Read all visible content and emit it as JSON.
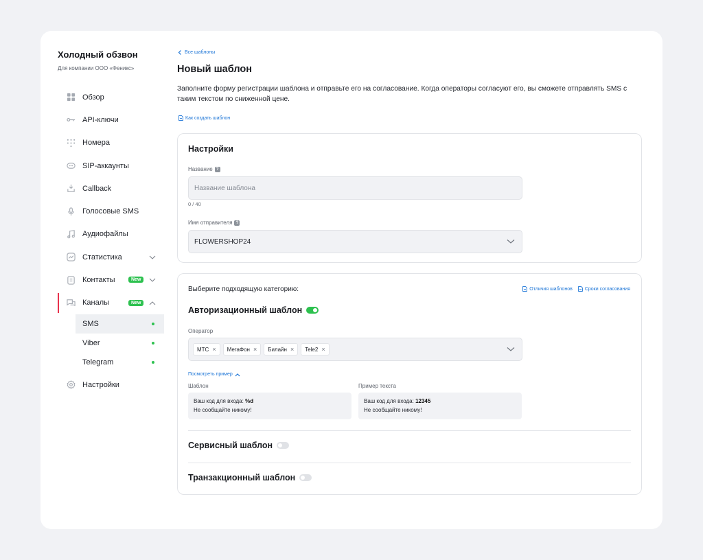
{
  "sidebar": {
    "title": "Холодный обзвон",
    "subtitle": "Для компании ООО «Феникс»",
    "items": [
      {
        "label": "Обзор",
        "icon": "grid-icon"
      },
      {
        "label": "API-ключи",
        "icon": "key-icon"
      },
      {
        "label": "Номера",
        "icon": "dialpad-icon"
      },
      {
        "label": "SIP-аккаунты",
        "icon": "sip-icon"
      },
      {
        "label": "Callback",
        "icon": "callback-icon"
      },
      {
        "label": "Голосовые SMS",
        "icon": "microphone-icon"
      },
      {
        "label": "Аудиофайлы",
        "icon": "music-note-icon"
      },
      {
        "label": "Статистика",
        "icon": "chart-icon"
      },
      {
        "label": "Контакты",
        "icon": "contacts-icon",
        "badge": "New"
      },
      {
        "label": "Каналы",
        "icon": "chat-icon",
        "badge": "New"
      },
      {
        "label": "Настройки",
        "icon": "gear-icon"
      }
    ],
    "channels": [
      {
        "label": "SMS",
        "selected": true
      },
      {
        "label": "Viber"
      },
      {
        "label": "Telegram"
      }
    ]
  },
  "main": {
    "back_link": "Все шаблоны",
    "title": "Новый шаблон",
    "intro": "Заполните форму регистрации шаблона и отправьте его на согласование. Когда операторы согласуют его, вы сможете отправлять SMS с таким текстом по сниженной цене.",
    "howto_link": "Как создать шаблон"
  },
  "settings": {
    "title": "Настройки",
    "name_label": "Название",
    "name_placeholder": "Название шаблона",
    "name_counter": "0 / 40",
    "sender_label": "Имя отправителя",
    "sender_value": "FLOWERSHOP24"
  },
  "category": {
    "prompt": "Выберите подходящую категорию:",
    "link_diff": "Отличия шаблонов",
    "link_terms": "Сроки согласования",
    "auth_title": "Авторизационный шаблон",
    "auth_enabled": true,
    "operator_label": "Оператор",
    "operators": [
      "МТС",
      "МегаФон",
      "Билайн",
      "Tele2"
    ],
    "see_example": "Посмотреть пример",
    "template_label": "Шаблон",
    "template_line1_prefix": "Ваш код для входа: ",
    "template_line1_value": "%d",
    "template_line2": "Не сообщайте никому!",
    "example_label": "Пример текста",
    "example_line1_prefix": "Ваш код для входа: ",
    "example_line1_value": "12345",
    "example_line2": "Не сообщайте никому!",
    "service_title": "Сервисный шаблон",
    "service_enabled": false,
    "transaction_title": "Транзакционный шаблон",
    "transaction_enabled": false
  },
  "colors": {
    "accent_link": "#1973d6",
    "toggle_on": "#2dc14f",
    "badge": "#2dc14f",
    "active_marker": "#e8324c"
  }
}
